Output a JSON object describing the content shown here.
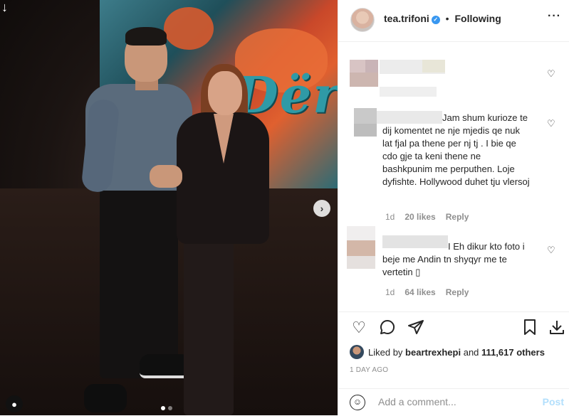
{
  "header": {
    "username": "tea.trifoni",
    "separator": "•",
    "follow_status": "Following",
    "more_icon": "more-horizontal-icon"
  },
  "media": {
    "backdrop_text": "Dër",
    "carousel_dots": 2,
    "active_dot": 0
  },
  "comments": [
    {
      "text": "Jam shum kurioze te dij komentet ne nje mjedis qe nuk lat fjal pa thene per nj tj . I bie qe cdo gje ta keni thene ne bashkpunim me perputhen. Loje dyfishte. Hollywood duhet tju vlersoj",
      "age": "1d",
      "likes": "20 likes",
      "reply": "Reply"
    },
    {
      "text": "I Eh dikur kto foto i beje me Andin tn shyqyr me te vertetin ▯",
      "age": "1d",
      "likes": "64 likes",
      "reply": "Reply"
    }
  ],
  "likes": {
    "prefix": "Liked by",
    "user": "beartrexhepi",
    "and": "and",
    "count": "111,617 others"
  },
  "timestamp": "1 DAY AGO",
  "add_comment": {
    "placeholder": "Add a comment...",
    "post_label": "Post"
  },
  "colors": {
    "verified": "#3897f0",
    "post_disabled": "#b2dffc",
    "muted": "#8e8e8e"
  }
}
